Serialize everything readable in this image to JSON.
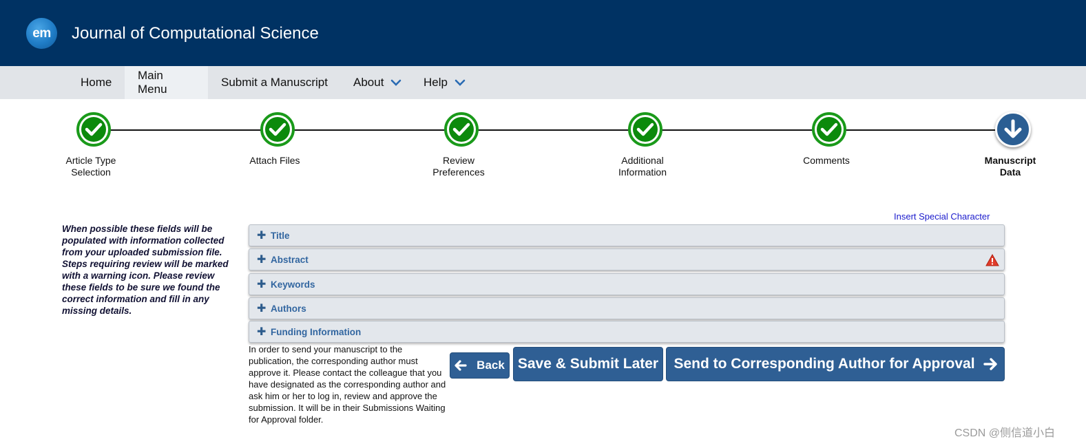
{
  "header": {
    "logo_text": "em",
    "journal_title": "Journal of Computational Science"
  },
  "nav": {
    "items": [
      {
        "label": "Home"
      },
      {
        "label": "Main Menu"
      },
      {
        "label": "Submit a Manuscript"
      },
      {
        "label": "About"
      },
      {
        "label": "Help"
      }
    ],
    "active": "Main Menu"
  },
  "steps": [
    {
      "label_line1": "Article Type",
      "label_line2": "Selection",
      "status": "complete"
    },
    {
      "label_line1": "Attach Files",
      "label_line2": "",
      "status": "complete"
    },
    {
      "label_line1": "Review",
      "label_line2": "Preferences",
      "status": "complete"
    },
    {
      "label_line1": "Additional",
      "label_line2": "Information",
      "status": "complete"
    },
    {
      "label_line1": "Comments",
      "label_line2": "",
      "status": "complete"
    },
    {
      "label_line1": "Manuscript",
      "label_line2": "Data",
      "status": "current"
    }
  ],
  "instructions": "When possible these fields will be populated with information collected from your uploaded submission file. Steps requiring review will be marked with a warning icon. Please review these fields to be sure we found the correct information and fill in any missing details.",
  "insert_special_character": "Insert Special Character",
  "sections": [
    {
      "label": "Title",
      "warning": false
    },
    {
      "label": "Abstract",
      "warning": true
    },
    {
      "label": "Keywords",
      "warning": false
    },
    {
      "label": "Authors",
      "warning": false
    },
    {
      "label": "Funding Information",
      "warning": false
    }
  ],
  "notice": "In order to send your manuscript to the publication, the corresponding author must approve it. Please contact the colleague that you have designated as the corresponding author and ask him or her to log in, review and approve the submission. It will be in their Submissions Waiting for Approval folder.",
  "buttons": {
    "back": "Back",
    "save_later": "Save & Submit Later",
    "send": "Send to Corresponding Author for Approval"
  },
  "watermark": "CSDN @侧信道小白",
  "colors": {
    "header_bg": "#003263",
    "nav_bg": "#e1e4e8",
    "complete_green": "#0c8a0c",
    "current_blue": "#2b5e93",
    "button_blue": "#2f5f94",
    "section_label": "#3266a0"
  }
}
